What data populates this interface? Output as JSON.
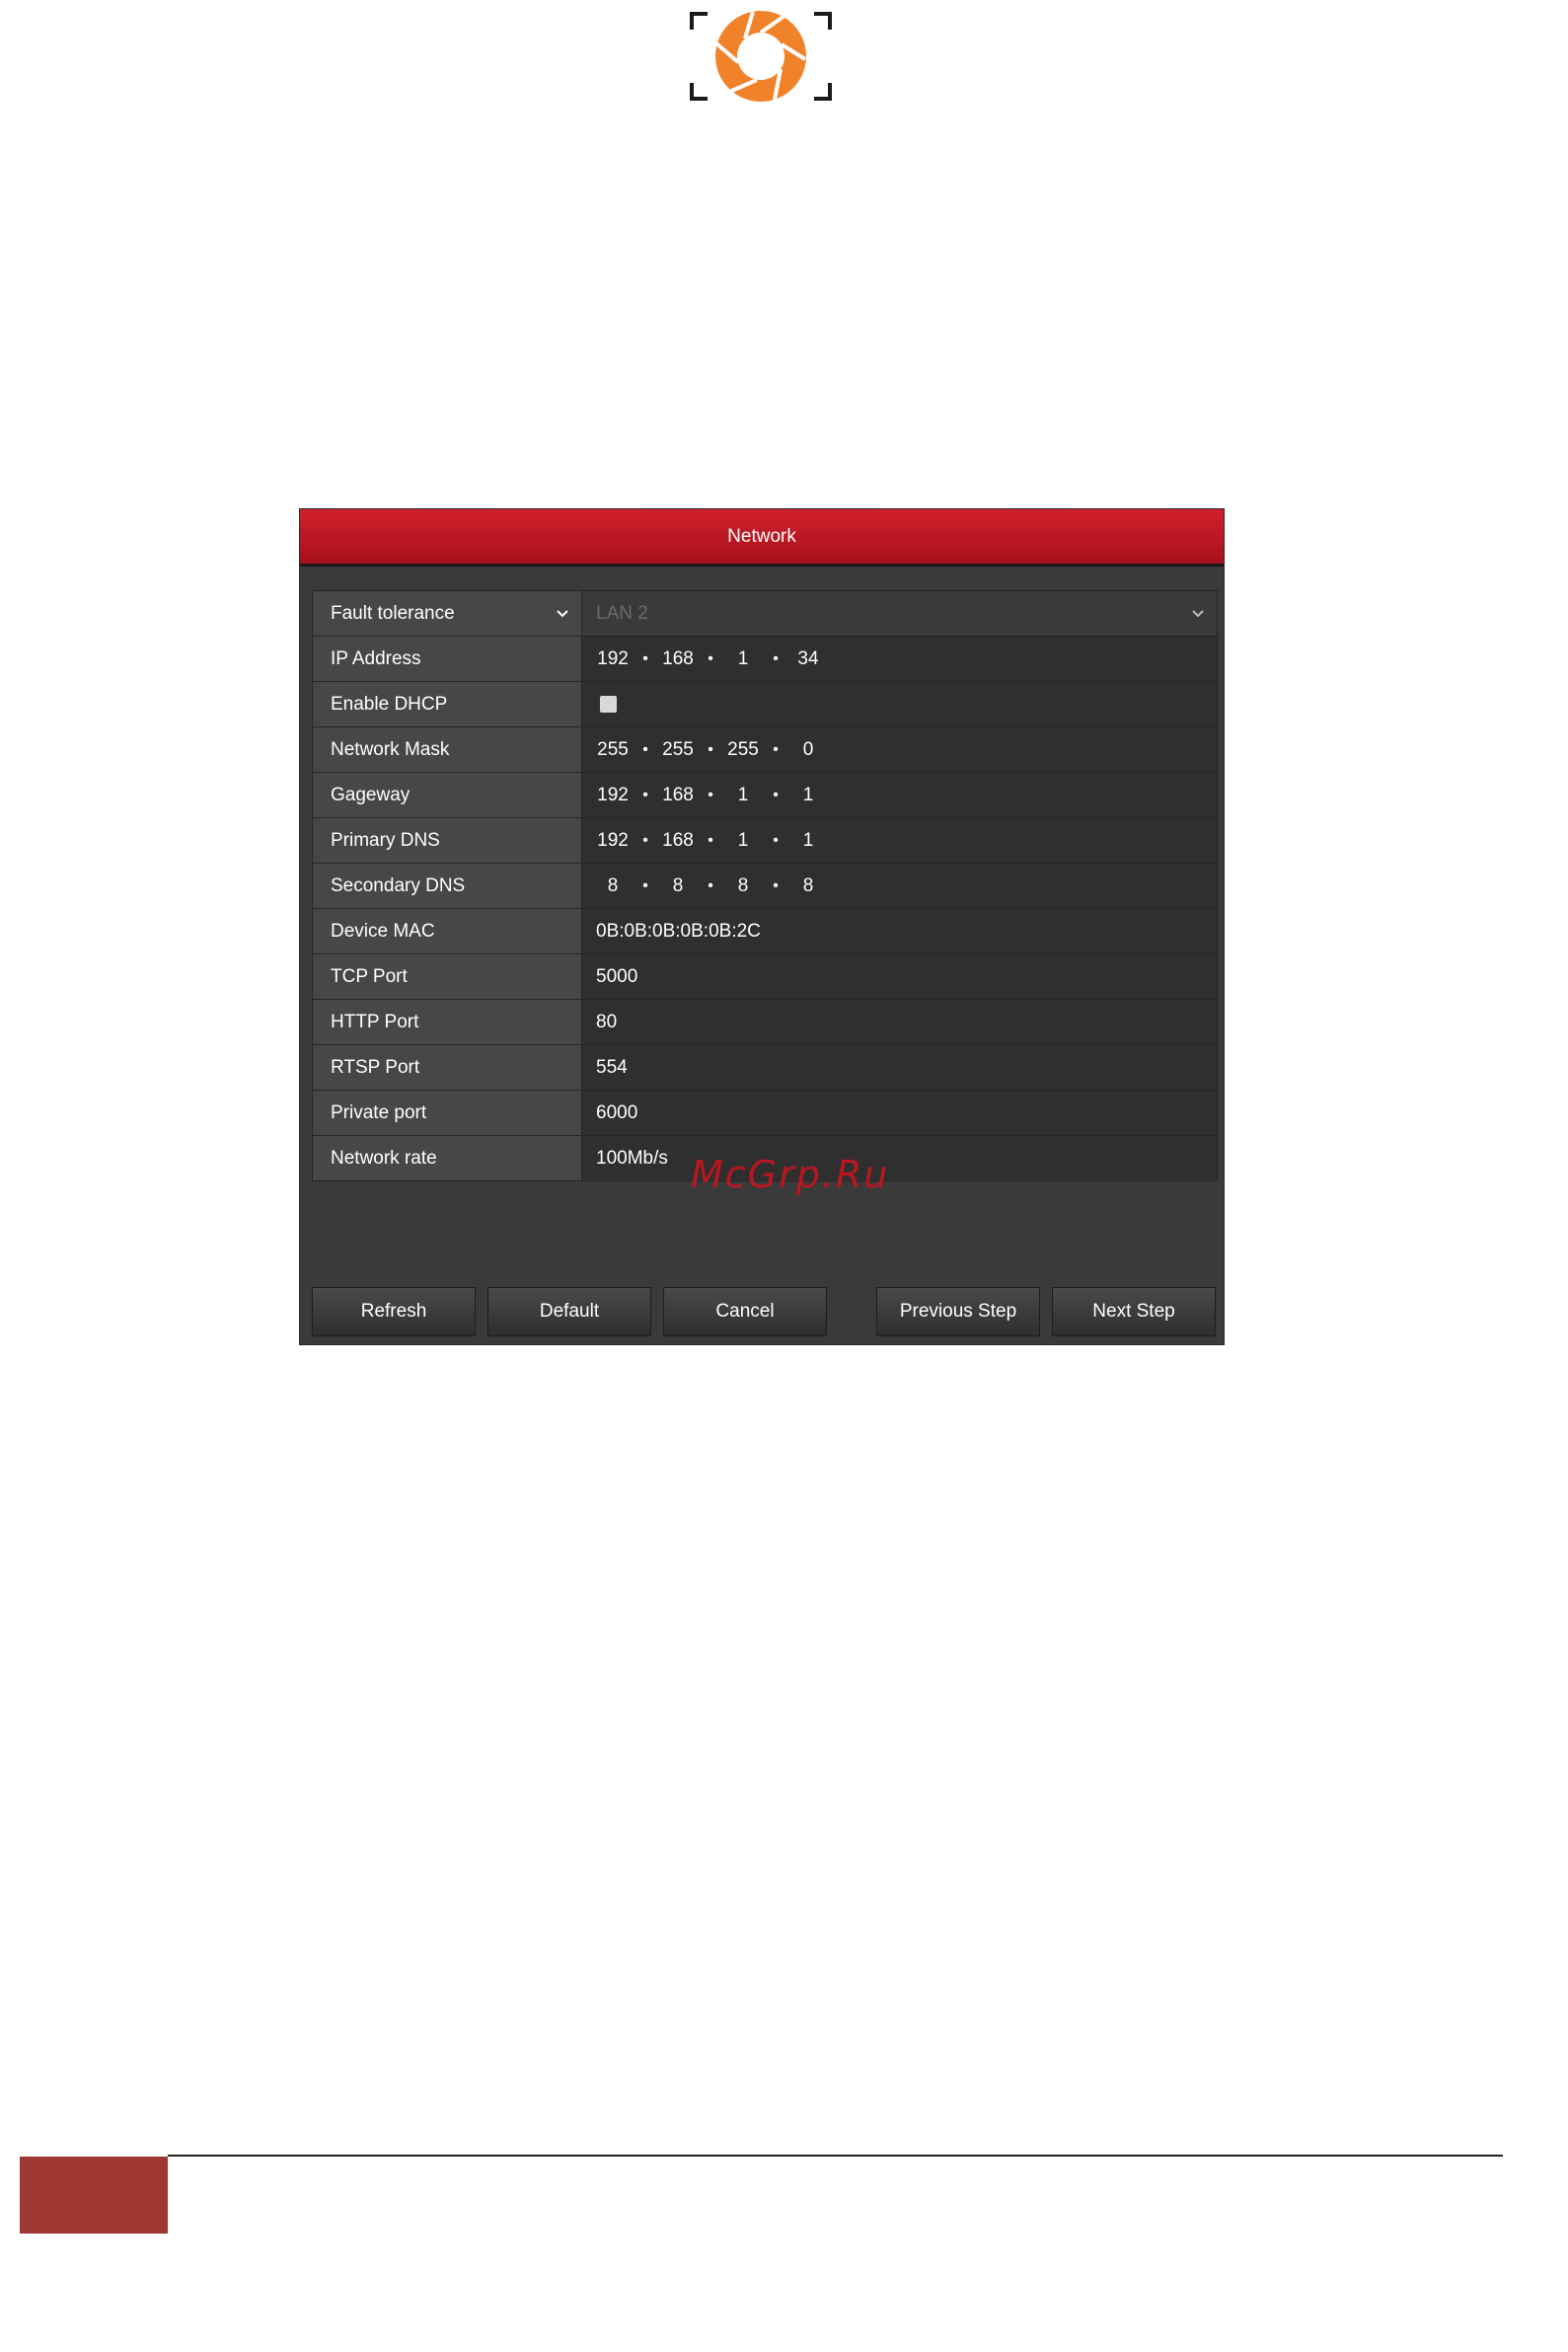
{
  "dialog": {
    "title": "Network",
    "rows": {
      "fault_tolerance": {
        "label": "Fault tolerance",
        "value": "LAN 2"
      },
      "ip_address": {
        "label": "IP Address",
        "octets": [
          "192",
          "168",
          "1",
          "34"
        ]
      },
      "enable_dhcp": {
        "label": "Enable DHCP",
        "checked": false
      },
      "network_mask": {
        "label": "Network Mask",
        "octets": [
          "255",
          "255",
          "255",
          "0"
        ]
      },
      "gateway": {
        "label": "Gageway",
        "octets": [
          "192",
          "168",
          "1",
          "1"
        ]
      },
      "primary_dns": {
        "label": "Primary DNS",
        "octets": [
          "192",
          "168",
          "1",
          "1"
        ]
      },
      "secondary_dns": {
        "label": "Secondary DNS",
        "octets": [
          "8",
          "8",
          "8",
          "8"
        ]
      },
      "device_mac": {
        "label": "Device MAC",
        "value": "0B:0B:0B:0B:0B:2C"
      },
      "tcp_port": {
        "label": "TCP Port",
        "value": "5000"
      },
      "http_port": {
        "label": "HTTP Port",
        "value": "80"
      },
      "rtsp_port": {
        "label": "RTSP Port",
        "value": "554"
      },
      "private_port": {
        "label": "Private port",
        "value": "6000"
      },
      "network_rate": {
        "label": "Network rate",
        "value": "100Mb/s"
      }
    },
    "buttons": {
      "refresh": "Refresh",
      "default": "Default",
      "cancel": "Cancel",
      "previous": "Previous Step",
      "next": "Next Step"
    }
  },
  "watermark": "McGrp.Ru",
  "colors": {
    "title_bar": "#c2141f",
    "logo_orange": "#f0832a",
    "footer_block": "#9e3631"
  }
}
